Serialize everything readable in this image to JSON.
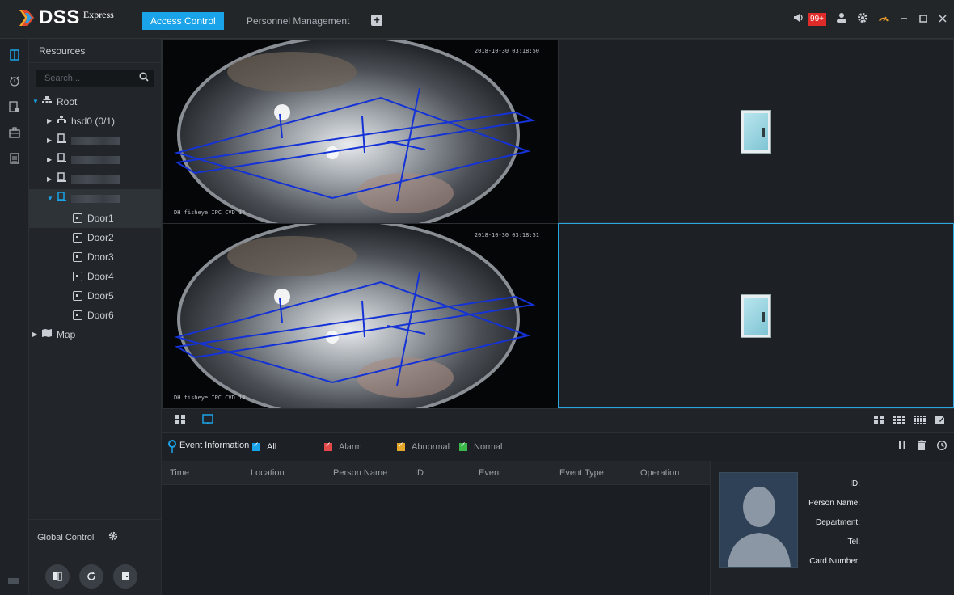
{
  "app": {
    "brand": "DSS",
    "brand_sub": "Express"
  },
  "tabs": [
    {
      "label": "Access Control",
      "active": true
    },
    {
      "label": "Personnel Management",
      "active": false
    }
  ],
  "topbar": {
    "alarm_badge": "99+"
  },
  "resources": {
    "title": "Resources",
    "search_placeholder": "Search...",
    "root_label": "Root",
    "hsd_label": "hsd0 (0/1)",
    "doors": [
      "Door1",
      "Door2",
      "Door3",
      "Door4",
      "Door5",
      "Door6"
    ],
    "map_label": "Map"
  },
  "global_control": {
    "label": "Global Control"
  },
  "video": {
    "stamp_top_1": "2018-10-30 03:18:50",
    "stamp_bottom_1": "DH fisheye  IPC  CVD  14",
    "stamp_top_2": "2018-10-30 03:18:51",
    "stamp_bottom_2": "DH fisheye  IPC  CVD  14"
  },
  "events": {
    "title": "Event Information",
    "filters": [
      {
        "label": "All",
        "color": "#1aa3e8"
      },
      {
        "label": "Alarm",
        "color": "#e24a4a"
      },
      {
        "label": "Abnormal",
        "color": "#e3a82b"
      },
      {
        "label": "Normal",
        "color": "#3db84a"
      }
    ],
    "columns": [
      "Time",
      "Location",
      "Person Name",
      "ID",
      "Event",
      "Event Type",
      "Operation"
    ]
  },
  "person_info": {
    "id_label": "ID:",
    "name_label": "Person Name:",
    "dept_label": "Department:",
    "tel_label": "Tel:",
    "card_label": "Card Number:"
  }
}
